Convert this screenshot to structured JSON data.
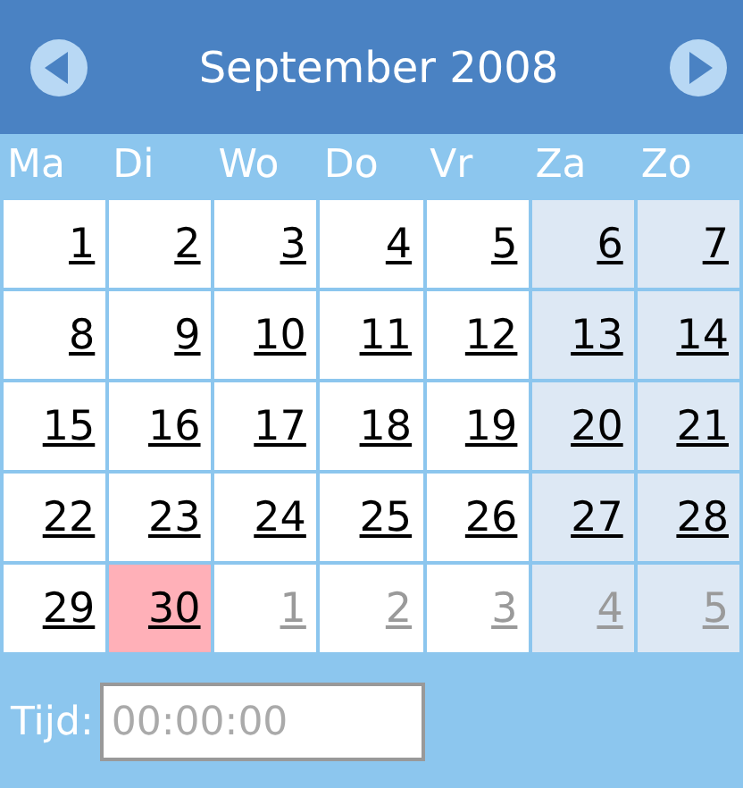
{
  "header": {
    "title": "September 2008"
  },
  "weekdays": [
    {
      "label": "Ma"
    },
    {
      "label": "Di"
    },
    {
      "label": "Wo"
    },
    {
      "label": "Do"
    },
    {
      "label": "Vr"
    },
    {
      "label": "Za"
    },
    {
      "label": "Zo"
    }
  ],
  "weeks": [
    [
      {
        "label": "1",
        "weekend": false,
        "other_month": false,
        "selected": false
      },
      {
        "label": "2",
        "weekend": false,
        "other_month": false,
        "selected": false
      },
      {
        "label": "3",
        "weekend": false,
        "other_month": false,
        "selected": false
      },
      {
        "label": "4",
        "weekend": false,
        "other_month": false,
        "selected": false
      },
      {
        "label": "5",
        "weekend": false,
        "other_month": false,
        "selected": false
      },
      {
        "label": "6",
        "weekend": true,
        "other_month": false,
        "selected": false
      },
      {
        "label": "7",
        "weekend": true,
        "other_month": false,
        "selected": false
      }
    ],
    [
      {
        "label": "8",
        "weekend": false,
        "other_month": false,
        "selected": false
      },
      {
        "label": "9",
        "weekend": false,
        "other_month": false,
        "selected": false
      },
      {
        "label": "10",
        "weekend": false,
        "other_month": false,
        "selected": false
      },
      {
        "label": "11",
        "weekend": false,
        "other_month": false,
        "selected": false
      },
      {
        "label": "12",
        "weekend": false,
        "other_month": false,
        "selected": false
      },
      {
        "label": "13",
        "weekend": true,
        "other_month": false,
        "selected": false
      },
      {
        "label": "14",
        "weekend": true,
        "other_month": false,
        "selected": false
      }
    ],
    [
      {
        "label": "15",
        "weekend": false,
        "other_month": false,
        "selected": false
      },
      {
        "label": "16",
        "weekend": false,
        "other_month": false,
        "selected": false
      },
      {
        "label": "17",
        "weekend": false,
        "other_month": false,
        "selected": false
      },
      {
        "label": "18",
        "weekend": false,
        "other_month": false,
        "selected": false
      },
      {
        "label": "19",
        "weekend": false,
        "other_month": false,
        "selected": false
      },
      {
        "label": "20",
        "weekend": true,
        "other_month": false,
        "selected": false
      },
      {
        "label": "21",
        "weekend": true,
        "other_month": false,
        "selected": false
      }
    ],
    [
      {
        "label": "22",
        "weekend": false,
        "other_month": false,
        "selected": false
      },
      {
        "label": "23",
        "weekend": false,
        "other_month": false,
        "selected": false
      },
      {
        "label": "24",
        "weekend": false,
        "other_month": false,
        "selected": false
      },
      {
        "label": "25",
        "weekend": false,
        "other_month": false,
        "selected": false
      },
      {
        "label": "26",
        "weekend": false,
        "other_month": false,
        "selected": false
      },
      {
        "label": "27",
        "weekend": true,
        "other_month": false,
        "selected": false
      },
      {
        "label": "28",
        "weekend": true,
        "other_month": false,
        "selected": false
      }
    ],
    [
      {
        "label": "29",
        "weekend": false,
        "other_month": false,
        "selected": false
      },
      {
        "label": "30",
        "weekend": false,
        "other_month": false,
        "selected": true
      },
      {
        "label": "1",
        "weekend": false,
        "other_month": true,
        "selected": false
      },
      {
        "label": "2",
        "weekend": false,
        "other_month": true,
        "selected": false
      },
      {
        "label": "3",
        "weekend": false,
        "other_month": true,
        "selected": false
      },
      {
        "label": "4",
        "weekend": true,
        "other_month": true,
        "selected": false
      },
      {
        "label": "5",
        "weekend": true,
        "other_month": true,
        "selected": false
      }
    ]
  ],
  "time": {
    "label": "Tijd:",
    "placeholder": "00:00:00"
  }
}
